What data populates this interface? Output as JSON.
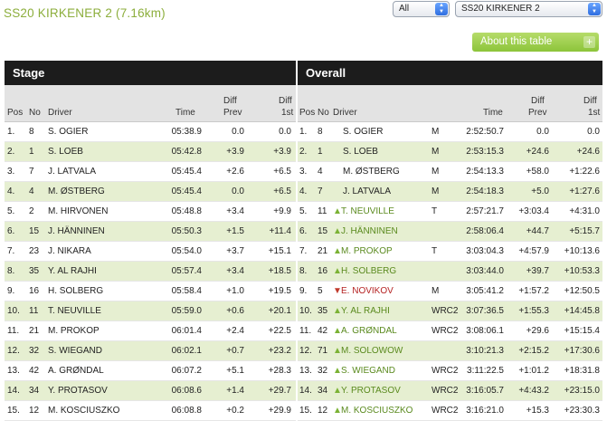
{
  "title": "SS20 KIRKENER 2 (7.16km)",
  "filter": {
    "scope": "All",
    "stage": "SS20 KIRKENER 2"
  },
  "about_button": "About this table",
  "stage": {
    "heading": "Stage",
    "columns": {
      "pos": "Pos",
      "no": "No",
      "driver": "Driver",
      "time": "Time",
      "diff_prev": [
        "Diff",
        "Prev"
      ],
      "diff_1st": [
        "Diff",
        "1st"
      ]
    },
    "rows": [
      {
        "pos": "1.",
        "no": "8",
        "driver": "S. OGIER",
        "time": "05:38.9",
        "prev": "0.0",
        "first": "0.0"
      },
      {
        "pos": "2.",
        "no": "1",
        "driver": "S. LOEB",
        "time": "05:42.8",
        "prev": "+3.9",
        "first": "+3.9"
      },
      {
        "pos": "3.",
        "no": "7",
        "driver": "J. LATVALA",
        "time": "05:45.4",
        "prev": "+2.6",
        "first": "+6.5"
      },
      {
        "pos": "4.",
        "no": "4",
        "driver": "M. ØSTBERG",
        "time": "05:45.4",
        "prev": "0.0",
        "first": "+6.5"
      },
      {
        "pos": "5.",
        "no": "2",
        "driver": "M. HIRVONEN",
        "time": "05:48.8",
        "prev": "+3.4",
        "first": "+9.9"
      },
      {
        "pos": "6.",
        "no": "15",
        "driver": "J. HÄNNINEN",
        "time": "05:50.3",
        "prev": "+1.5",
        "first": "+11.4"
      },
      {
        "pos": "7.",
        "no": "23",
        "driver": "J. NIKARA",
        "time": "05:54.0",
        "prev": "+3.7",
        "first": "+15.1"
      },
      {
        "pos": "8.",
        "no": "35",
        "driver": "Y. AL RAJHI",
        "time": "05:57.4",
        "prev": "+3.4",
        "first": "+18.5"
      },
      {
        "pos": "9.",
        "no": "16",
        "driver": "H. SOLBERG",
        "time": "05:58.4",
        "prev": "+1.0",
        "first": "+19.5"
      },
      {
        "pos": "10.",
        "no": "11",
        "driver": "T. NEUVILLE",
        "time": "05:59.0",
        "prev": "+0.6",
        "first": "+20.1"
      },
      {
        "pos": "11.",
        "no": "21",
        "driver": "M. PROKOP",
        "time": "06:01.4",
        "prev": "+2.4",
        "first": "+22.5"
      },
      {
        "pos": "12.",
        "no": "32",
        "driver": "S. WIEGAND",
        "time": "06:02.1",
        "prev": "+0.7",
        "first": "+23.2"
      },
      {
        "pos": "13.",
        "no": "42",
        "driver": "A. GRØNDAL",
        "time": "06:07.2",
        "prev": "+5.1",
        "first": "+28.3"
      },
      {
        "pos": "14.",
        "no": "34",
        "driver": "Y. PROTASOV",
        "time": "06:08.6",
        "prev": "+1.4",
        "first": "+29.7"
      },
      {
        "pos": "15.",
        "no": "12",
        "driver": "M. KOSCIUSZKO",
        "time": "06:08.8",
        "prev": "+0.2",
        "first": "+29.9"
      }
    ]
  },
  "overall": {
    "heading": "Overall",
    "columns": {
      "pos": "Pos",
      "no": "No",
      "driver": "Driver",
      "time": "Time",
      "diff_prev": [
        "Diff",
        "Prev"
      ],
      "diff_1st": [
        "Diff",
        "1st"
      ]
    },
    "rows": [
      {
        "pos": "1.",
        "no": "8",
        "move": "",
        "driver": "S. OGIER",
        "cls": "M",
        "time": "2:52:50.7",
        "prev": "0.0",
        "first": "0.0"
      },
      {
        "pos": "2.",
        "no": "1",
        "move": "",
        "driver": "S. LOEB",
        "cls": "M",
        "time": "2:53:15.3",
        "prev": "+24.6",
        "first": "+24.6"
      },
      {
        "pos": "3.",
        "no": "4",
        "move": "",
        "driver": "M. ØSTBERG",
        "cls": "M",
        "time": "2:54:13.3",
        "prev": "+58.0",
        "first": "+1:22.6"
      },
      {
        "pos": "4.",
        "no": "7",
        "move": "",
        "driver": "J. LATVALA",
        "cls": "M",
        "time": "2:54:18.3",
        "prev": "+5.0",
        "first": "+1:27.6"
      },
      {
        "pos": "5.",
        "no": "11",
        "move": "up",
        "driver": "T. NEUVILLE",
        "cls": "T",
        "time": "2:57:21.7",
        "prev": "+3:03.4",
        "first": "+4:31.0"
      },
      {
        "pos": "6.",
        "no": "15",
        "move": "up",
        "driver": "J. HÄNNINEN",
        "cls": "",
        "time": "2:58:06.4",
        "prev": "+44.7",
        "first": "+5:15.7"
      },
      {
        "pos": "7.",
        "no": "21",
        "move": "up",
        "driver": "M. PROKOP",
        "cls": "T",
        "time": "3:03:04.3",
        "prev": "+4:57.9",
        "first": "+10:13.6"
      },
      {
        "pos": "8.",
        "no": "16",
        "move": "up",
        "driver": "H. SOLBERG",
        "cls": "",
        "time": "3:03:44.0",
        "prev": "+39.7",
        "first": "+10:53.3"
      },
      {
        "pos": "9.",
        "no": "5",
        "move": "down",
        "driver": "E. NOVIKOV",
        "cls": "M",
        "time": "3:05:41.2",
        "prev": "+1:57.2",
        "first": "+12:50.5"
      },
      {
        "pos": "10.",
        "no": "35",
        "move": "up",
        "driver": "Y. AL RAJHI",
        "cls": "WRC2",
        "time": "3:07:36.5",
        "prev": "+1:55.3",
        "first": "+14:45.8"
      },
      {
        "pos": "11.",
        "no": "42",
        "move": "up",
        "driver": "A. GRØNDAL",
        "cls": "WRC2",
        "time": "3:08:06.1",
        "prev": "+29.6",
        "first": "+15:15.4"
      },
      {
        "pos": "12.",
        "no": "71",
        "move": "up",
        "driver": "M. SOLOWOW",
        "cls": "",
        "time": "3:10:21.3",
        "prev": "+2:15.2",
        "first": "+17:30.6"
      },
      {
        "pos": "13.",
        "no": "32",
        "move": "up",
        "driver": "S. WIEGAND",
        "cls": "WRC2",
        "time": "3:11:22.5",
        "prev": "+1:01.2",
        "first": "+18:31.8"
      },
      {
        "pos": "14.",
        "no": "34",
        "move": "up",
        "driver": "Y. PROTASOV",
        "cls": "WRC2",
        "time": "3:16:05.7",
        "prev": "+4:43.2",
        "first": "+23:15.0"
      },
      {
        "pos": "15.",
        "no": "12",
        "move": "up",
        "driver": "M. KOSCIUSZKO",
        "cls": "WRC2",
        "time": "3:16:21.0",
        "prev": "+15.3",
        "first": "+23:30.3"
      }
    ]
  },
  "colors": {
    "accent": "#8cae3c",
    "row_alt": "#e6efd1",
    "header_bg": "#1c1c1c",
    "up": "#7bb234",
    "down": "#c0392b"
  }
}
